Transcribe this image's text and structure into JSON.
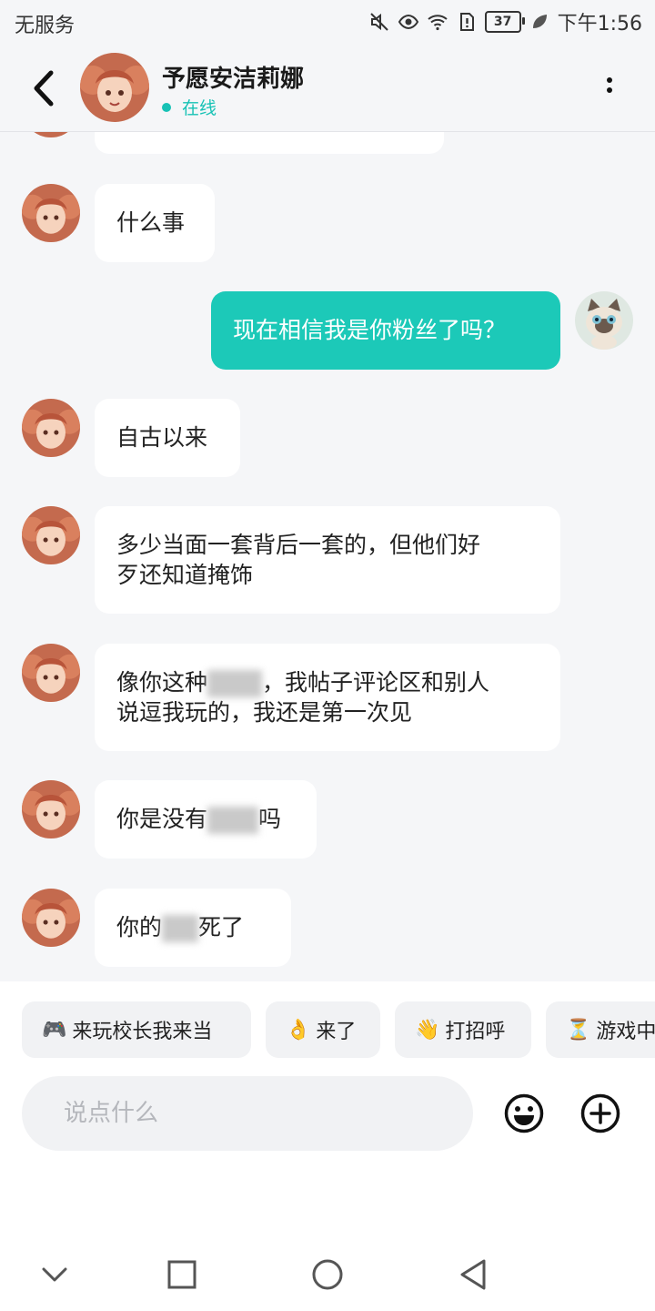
{
  "status_bar": {
    "carrier": "无服务",
    "battery": "37",
    "time": "下午1:56"
  },
  "header": {
    "contact_name": "予愿安洁莉娜",
    "status": "在线",
    "status_color": "#17c2b5"
  },
  "messages": [
    {
      "from": "them",
      "text": ""
    },
    {
      "from": "them",
      "text": "什么事"
    },
    {
      "from": "me",
      "text": "现在相信我是你粉丝了吗？"
    },
    {
      "from": "them",
      "text": "自古以来"
    },
    {
      "from": "them",
      "lines": [
        "多少当面一套背后一套的，但他们好",
        "歹还知道掩饰"
      ]
    },
    {
      "from": "them",
      "lines": [
        "像你这种",
        "，我帖子评论区和别人",
        "说逗我玩的，我还是第一次见"
      ]
    },
    {
      "from": "them",
      "parts": [
        "你是没有",
        "吗"
      ]
    },
    {
      "from": "them",
      "parts": [
        "你的",
        "死了"
      ]
    }
  ],
  "quick_replies": [
    {
      "icon": "🎮",
      "label": "来玩校长我来当"
    },
    {
      "icon": "👌",
      "label": "来了"
    },
    {
      "icon": "👋",
      "label": "打招呼"
    },
    {
      "icon": "⏳",
      "label": "游戏中"
    }
  ],
  "input": {
    "placeholder": "说点什么",
    "value": ""
  },
  "colors": {
    "accent": "#1cc9b8",
    "background": "#f5f6f8",
    "bubble_them": "#ffffff"
  }
}
